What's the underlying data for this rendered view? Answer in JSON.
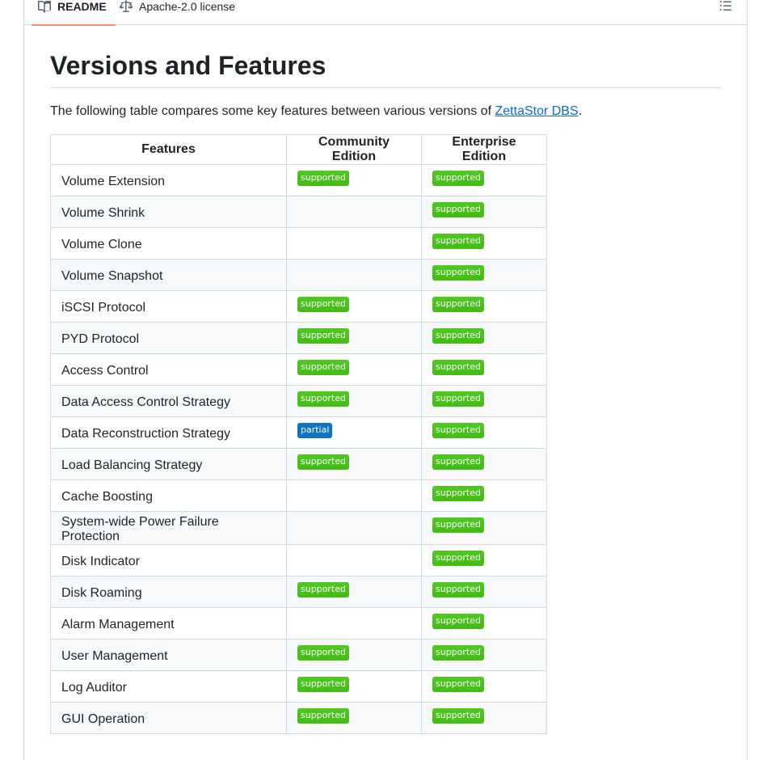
{
  "tabs": {
    "readme": "README",
    "license": "Apache-2.0 license"
  },
  "section": {
    "title": "Versions and Features",
    "intro_prefix": "The following table compares some key features between various versions of ",
    "intro_link": "ZettaStor DBS",
    "intro_suffix": "."
  },
  "table": {
    "headers": [
      "Features",
      "Community Edition",
      "Enterprise Edition"
    ],
    "rows": [
      {
        "feature": "Volume Extension",
        "community": "supported",
        "enterprise": "supported"
      },
      {
        "feature": "Volume Shrink",
        "community": "",
        "enterprise": "supported"
      },
      {
        "feature": "Volume Clone",
        "community": "",
        "enterprise": "supported"
      },
      {
        "feature": "Volume Snapshot",
        "community": "",
        "enterprise": "supported"
      },
      {
        "feature": "iSCSI Protocol",
        "community": "supported",
        "enterprise": "supported"
      },
      {
        "feature": "PYD Protocol",
        "community": "supported",
        "enterprise": "supported"
      },
      {
        "feature": "Access Control",
        "community": "supported",
        "enterprise": "supported"
      },
      {
        "feature": "Data Access Control Strategy",
        "community": "supported",
        "enterprise": "supported"
      },
      {
        "feature": "Data Reconstruction Strategy",
        "community": "partial",
        "enterprise": "supported"
      },
      {
        "feature": "Load Balancing Strategy",
        "community": "supported",
        "enterprise": "supported"
      },
      {
        "feature": "Cache Boosting",
        "community": "",
        "enterprise": "supported"
      },
      {
        "feature": "System-wide Power Failure Protection",
        "community": "",
        "enterprise": "supported"
      },
      {
        "feature": "Disk Indicator",
        "community": "",
        "enterprise": "supported"
      },
      {
        "feature": "Disk Roaming",
        "community": "supported",
        "enterprise": "supported"
      },
      {
        "feature": "Alarm Management",
        "community": "",
        "enterprise": "supported"
      },
      {
        "feature": "User Management",
        "community": "supported",
        "enterprise": "supported"
      },
      {
        "feature": "Log Auditor",
        "community": "supported",
        "enterprise": "supported"
      },
      {
        "feature": "GUI Operation",
        "community": "supported",
        "enterprise": "supported"
      }
    ]
  },
  "colors": {
    "supported": "#44bb16",
    "partial": "#0d74c0",
    "link": "#0969da",
    "tab_underline": "#fd8c73"
  },
  "icons": {
    "readme": "book-icon",
    "license": "law-scale-icon",
    "toc": "list-unordered-icon"
  }
}
